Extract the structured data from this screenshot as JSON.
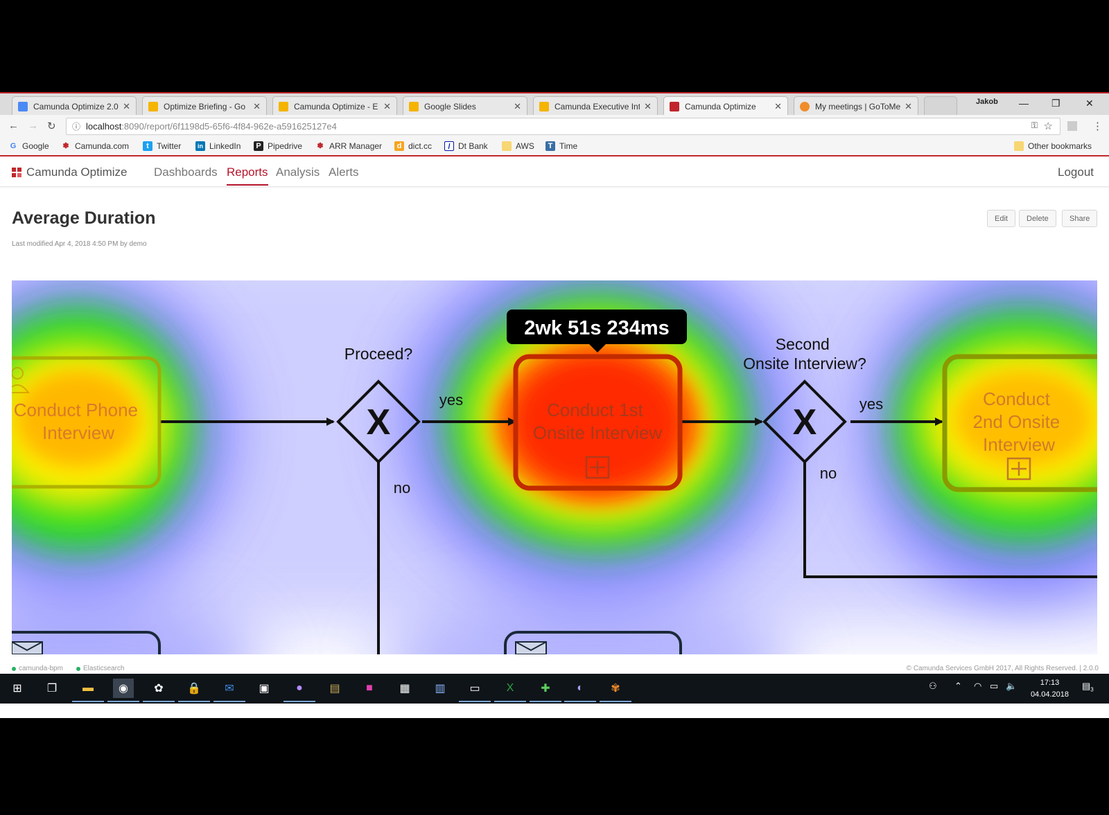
{
  "browser": {
    "tabs": [
      {
        "title": "Camunda Optimize 2.0",
        "favicon_color": "#4a8af4"
      },
      {
        "title": "Optimize Briefing - Go",
        "favicon_color": "#f4b400"
      },
      {
        "title": "Camunda Optimize - E",
        "favicon_color": "#f4b400"
      },
      {
        "title": "Google Slides",
        "favicon_color": "#f4b400"
      },
      {
        "title": "Camunda Executive Int",
        "favicon_color": "#f4b400"
      },
      {
        "title": "Camunda Optimize",
        "favicon_color": "#c0262c"
      },
      {
        "title": "My meetings | GoToMe",
        "favicon_color": "#f08c2a"
      }
    ],
    "profile_name": "Jakob",
    "url_host": "localhost",
    "url_path": ":8090/report/6f1198d5-65f6-4f84-962e-a591625127e4",
    "bookmarks": [
      {
        "label": "Google",
        "icon_color": "#4285f4",
        "glyph": "G"
      },
      {
        "label": "Camunda.com",
        "icon_color": "#c0262c",
        "glyph": "✽"
      },
      {
        "label": "Twitter",
        "icon_color": "#1da1f2",
        "glyph": "t"
      },
      {
        "label": "LinkedIn",
        "icon_color": "#0077b5",
        "glyph": "in"
      },
      {
        "label": "Pipedrive",
        "icon_color": "#222222",
        "glyph": "P"
      },
      {
        "label": "ARR Manager",
        "icon_color": "#c0262c",
        "glyph": "✽"
      },
      {
        "label": "dict.cc",
        "icon_color": "#f5a623",
        "glyph": "d"
      },
      {
        "label": "Dt Bank",
        "icon_color": "#0018a8",
        "glyph": "/"
      },
      {
        "label": "AWS",
        "icon_color": "#f7d774",
        "glyph": ""
      },
      {
        "label": "Time",
        "icon_color": "#3a6ea5",
        "glyph": "T"
      }
    ],
    "other_bookmarks": "Other bookmarks"
  },
  "app": {
    "brand": "Camunda Optimize",
    "nav": [
      "Dashboards",
      "Reports",
      "Analysis",
      "Alerts"
    ],
    "active_nav": "Reports",
    "logout": "Logout"
  },
  "report": {
    "title": "Average Duration",
    "meta": "Last modified Apr 4, 2018 4:50 PM by demo",
    "actions": {
      "edit": "Edit",
      "delete": "Delete",
      "share": "Share"
    }
  },
  "diagram": {
    "tooltip": "2wk 51s 234ms",
    "tasks": {
      "phone": "Conduct Phone\nInterview",
      "first": "Conduct 1st\nOnsite Interview",
      "second": "Conduct\n2nd Onsite\nInterview"
    },
    "gateways": {
      "proceed": "Proceed?",
      "second": "Second\nOnsite Interview?"
    },
    "flow_labels": {
      "yes1": "yes",
      "no1": "no",
      "yes2": "yes",
      "no2": "no"
    },
    "heat_colors": {
      "hot": "#ff2a00",
      "warm": "#ffee00",
      "mid": "#22dd22",
      "cool": "#6a6aff"
    }
  },
  "footer": {
    "status": [
      "camunda-bpm",
      "Elasticsearch"
    ],
    "copyright": "© Camunda Services GmbH 2017, All Rights Reserved. | 2.0.0"
  },
  "taskbar": {
    "time": "17:13",
    "date": "04.04.2018",
    "notifications": "3"
  }
}
